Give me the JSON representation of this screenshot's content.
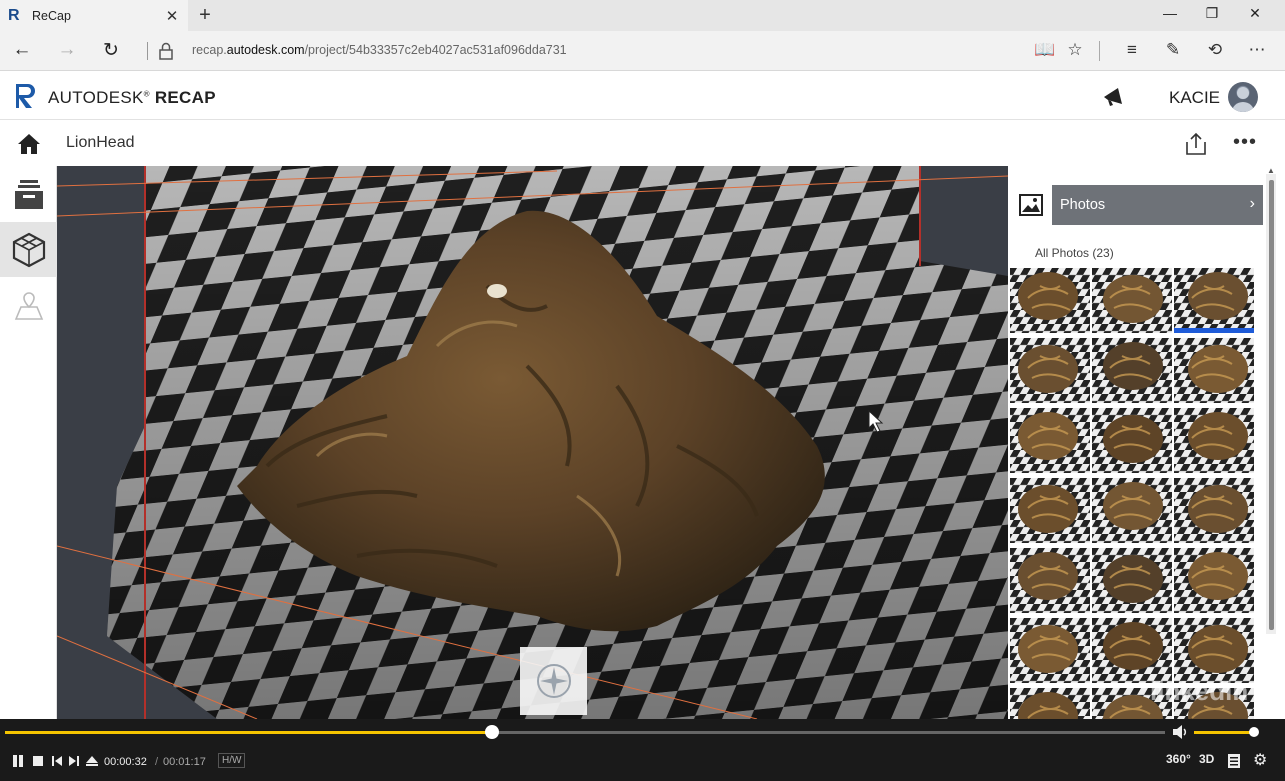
{
  "browser": {
    "tab_title": "ReCap",
    "url_prefix": "recap.",
    "url_host": "autodesk.com",
    "url_path": "/project/54b33357c2eb4027ac531af096dda731"
  },
  "app": {
    "brand_prefix": "AUTODESK",
    "brand_name": "RECAP",
    "brand_mark": "®",
    "user_name": "KACIE",
    "project_name": "LionHead"
  },
  "photos_panel": {
    "tab_label": "Photos",
    "all_photos_label": "All Photos (23)",
    "selected_index": 2
  },
  "player": {
    "current_time": "00:00:32",
    "separator": "/",
    "duration": "00:01:17",
    "progress": 0.42,
    "volume": 1.0,
    "hw_label": "H/W",
    "btn_360": "360°",
    "btn_3d": "3D",
    "watermark": "linkedin"
  },
  "colors": {
    "progress_accent": "#f5c400",
    "photo_selected": "#1e5bd8",
    "tab_bg": "#6e7278"
  }
}
